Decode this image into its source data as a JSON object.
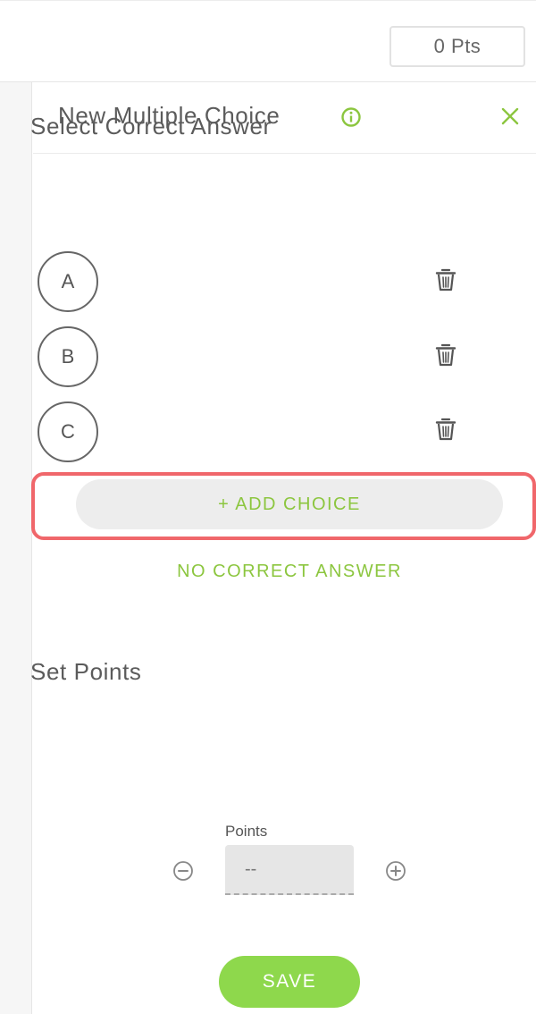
{
  "header": {
    "points_display": "0 Pts"
  },
  "panel": {
    "title": "New Multiple Choice"
  },
  "answers": {
    "section_title": "Select Correct Answer",
    "choices": [
      {
        "label": "A"
      },
      {
        "label": "B"
      },
      {
        "label": "C"
      }
    ],
    "add_choice_label": "+ ADD CHOICE",
    "no_correct_label": "NO CORRECT ANSWER"
  },
  "points": {
    "section_title": "Set Points",
    "field_label": "Points",
    "field_value": "--"
  },
  "actions": {
    "save_label": "SAVE"
  },
  "colors": {
    "accent_green": "#8cc63f",
    "save_green": "#8ed84c",
    "highlight_red": "#f0676b"
  },
  "icons": {
    "info": "info-icon",
    "close": "close-icon",
    "trash": "trash-icon",
    "minus": "minus-circle-icon",
    "plus": "plus-circle-icon"
  }
}
